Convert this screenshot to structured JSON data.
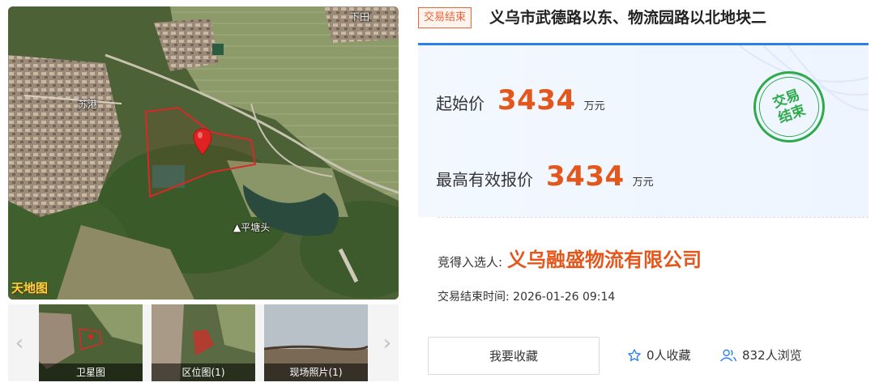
{
  "map": {
    "place_labels": [
      "苏港",
      "下田",
      "平塘头"
    ],
    "logo_text": "天地图",
    "marker_color": "#e02222",
    "boundary_color": "#d62a2a"
  },
  "thumbnails": [
    {
      "caption": "卫星图"
    },
    {
      "caption": "区位图(1)"
    },
    {
      "caption": "现场照片(1)"
    }
  ],
  "nav": {
    "prev_glyph": "‹",
    "next_glyph": "›"
  },
  "badge": "交易结束",
  "title": "义乌市武德路以东、物流园路以北地块二",
  "prices": {
    "start_label": "起始价",
    "start_value": "3434",
    "start_unit": "万元",
    "max_label": "最高有效报价",
    "max_value": "3434",
    "max_unit": "万元"
  },
  "stamp": {
    "line1": "交易",
    "line2": "结束"
  },
  "winner": {
    "label": "竞得入选人:",
    "value": "义乌融盛物流有限公司"
  },
  "end_time": "交易结束时间: 2026-01-26 09:14",
  "actions": {
    "favorite_button": "我要收藏",
    "favorites_count": "0人收藏",
    "views_count": "832人浏览"
  },
  "colors": {
    "accent_orange": "#e4571c",
    "accent_blue": "#2d7ff0",
    "stamp_green": "#2eaa4a"
  },
  "icons": [
    "star-icon",
    "users-icon",
    "map-marker-icon",
    "chevron-left-icon",
    "chevron-right-icon"
  ]
}
